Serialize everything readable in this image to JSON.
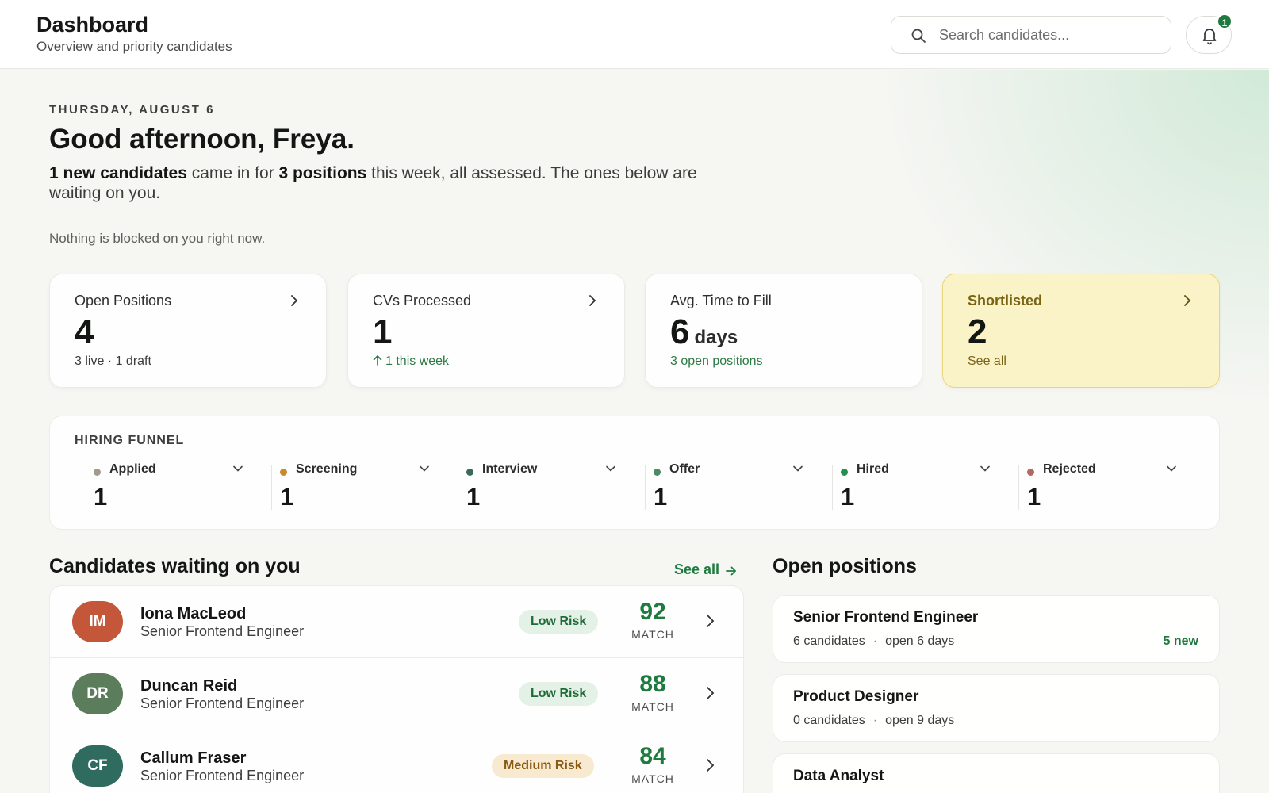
{
  "header": {
    "title": "Dashboard",
    "subtitle": "Overview and priority candidates",
    "search_placeholder": "Search candidates...",
    "notification_count": "1"
  },
  "welcome": {
    "date": "THURSDAY, AUGUST 6",
    "greeting": "Good afternoon, Freya.",
    "new_candidates": "1 new candidates",
    "came_in_for": " came in for ",
    "positions": "3 positions",
    "rest": " this week, all assessed. The ones below are waiting on you.",
    "blocked_note": "Nothing is blocked on you right now."
  },
  "stats": [
    {
      "label": "Open Positions",
      "value": "4",
      "unit": "",
      "sub": "3 live · 1 draft"
    },
    {
      "label": "CVs Processed",
      "value": "1",
      "unit": "",
      "sub": "1 this week"
    },
    {
      "label": "Avg. Time to Fill",
      "value": "6",
      "unit": "days",
      "sub": "3 open positions"
    },
    {
      "label": "Shortlisted",
      "value": "2",
      "unit": "",
      "sub": "See all"
    }
  ],
  "funnel": {
    "heading": "HIRING FUNNEL",
    "stages": [
      {
        "name": "Applied",
        "count": "1",
        "color": "#a39a8c"
      },
      {
        "name": "Screening",
        "count": "1",
        "color": "#c98a2b"
      },
      {
        "name": "Interview",
        "count": "1",
        "color": "#3b6b57"
      },
      {
        "name": "Offer",
        "count": "1",
        "color": "#4d8a63"
      },
      {
        "name": "Hired",
        "count": "1",
        "color": "#239050"
      },
      {
        "name": "Rejected",
        "count": "1",
        "color": "#b3695f"
      }
    ]
  },
  "candidates": {
    "title": "Candidates waiting on you",
    "see_all": "See all",
    "match_label": "MATCH",
    "items": [
      {
        "initials": "IM",
        "name": "Iona MacLeod",
        "role": "Senior Frontend Engineer",
        "risk": "Low Risk",
        "score": "92",
        "avatar_color": "#c4573a"
      },
      {
        "initials": "DR",
        "name": "Duncan Reid",
        "role": "Senior Frontend Engineer",
        "risk": "Low Risk",
        "score": "88",
        "avatar_color": "#5b7d5c"
      },
      {
        "initials": "CF",
        "name": "Callum Fraser",
        "role": "Senior Frontend Engineer",
        "risk": "Medium Risk",
        "score": "84",
        "avatar_color": "#2f6b5e"
      }
    ]
  },
  "positions": {
    "title": "Open positions",
    "items": [
      {
        "title": "Senior Frontend Engineer",
        "candidates": "6 candidates",
        "open": "open 6 days",
        "new": "5 new"
      },
      {
        "title": "Product Designer",
        "candidates": "0 candidates",
        "open": "open 9 days",
        "new": ""
      },
      {
        "title": "Data Analyst",
        "candidates": "",
        "open": "",
        "new": ""
      }
    ]
  }
}
